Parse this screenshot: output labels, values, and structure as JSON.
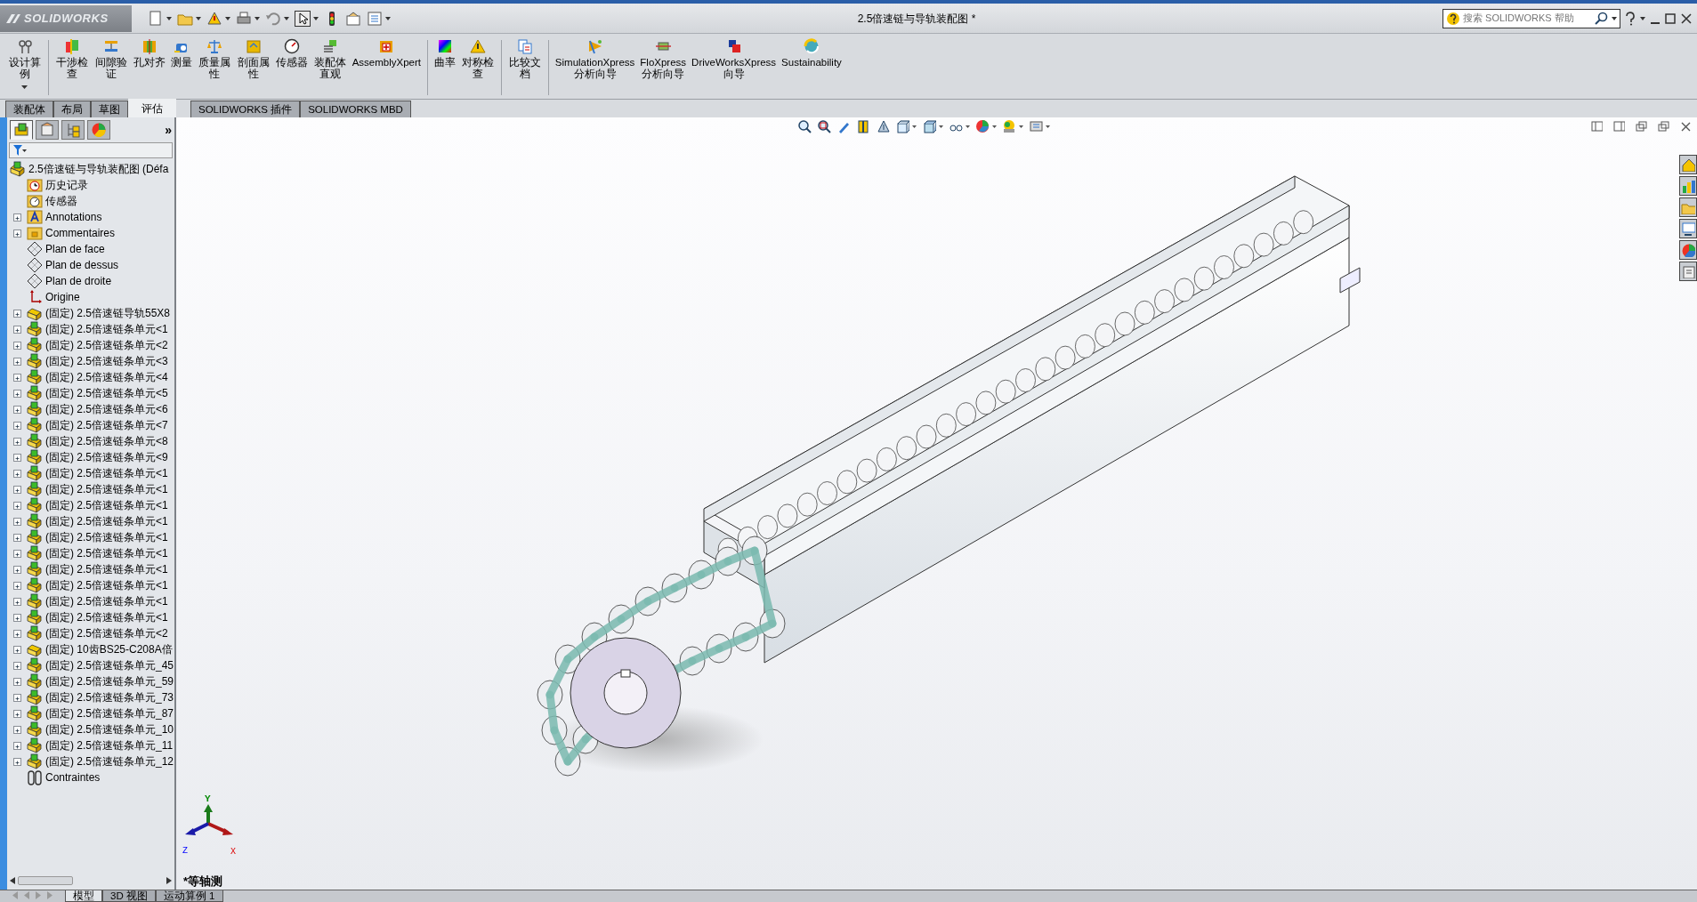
{
  "window": {
    "logo": "SOLIDWORKS",
    "title": "2.5倍速链与导轨装配图 *"
  },
  "search": {
    "placeholder": "搜索 SOLIDWORKS 帮助"
  },
  "ribbon_groups": [
    [
      {
        "label": "设计算例",
        "dropdown": true
      }
    ],
    [
      {
        "label": "干涉检查"
      },
      {
        "label": "间隙验证"
      },
      {
        "label": "孔对齐"
      },
      {
        "label": "测量"
      },
      {
        "label": "质量属性"
      },
      {
        "label": "剖面属性"
      },
      {
        "label": "传感器"
      },
      {
        "label": "装配体直观"
      },
      {
        "label": "AssemblyXpert"
      }
    ],
    [
      {
        "label": "曲率"
      },
      {
        "label": "对称检查"
      }
    ],
    [
      {
        "label": "比较文档"
      }
    ],
    [
      {
        "label": "SimulationXpress\n分析向导"
      },
      {
        "label": "FloXpress\n分析向导"
      },
      {
        "label": "DriveWorksXpress\n向导"
      },
      {
        "label": "Sustainability"
      }
    ]
  ],
  "command_tabs": [
    {
      "label": "装配体",
      "selected": false
    },
    {
      "label": "布局",
      "selected": false
    },
    {
      "label": "草图",
      "selected": false
    },
    {
      "label": "评估",
      "selected": true
    },
    {
      "label": "SOLIDWORKS 插件",
      "selected": false
    },
    {
      "label": "SOLIDWORKS MBD",
      "selected": false
    }
  ],
  "panel_tabs": [
    {
      "selected": true
    },
    {
      "selected": false
    },
    {
      "selected": false
    },
    {
      "selected": false
    }
  ],
  "panel_expand": "»",
  "tree": {
    "label": "2.5倍速链与导轨装配图  (Défa",
    "kind": "assembly",
    "children": [
      {
        "label": "历史记录",
        "kind": "history",
        "collapsed": false
      },
      {
        "label": "传感器",
        "kind": "sensor",
        "collapsed": false
      },
      {
        "label": "Annotations",
        "kind": "annotations",
        "collapsed": true
      },
      {
        "label": "Commentaires",
        "kind": "folder",
        "collapsed": true
      },
      {
        "label": "Plan de face",
        "kind": "plane",
        "collapsed": false
      },
      {
        "label": "Plan de dessus",
        "kind": "plane",
        "collapsed": false
      },
      {
        "label": "Plan de droite",
        "kind": "plane",
        "collapsed": false
      },
      {
        "label": "Origine",
        "kind": "origin",
        "collapsed": false
      },
      {
        "label": "(固定) 2.5倍速链导轨55X8",
        "kind": "part",
        "collapsed": true
      },
      {
        "label": "(固定) 2.5倍速链条单元<1",
        "kind": "assembly",
        "collapsed": true
      },
      {
        "label": "(固定) 2.5倍速链条单元<2",
        "kind": "assembly",
        "collapsed": true
      },
      {
        "label": "(固定) 2.5倍速链条单元<3",
        "kind": "assembly",
        "collapsed": true
      },
      {
        "label": "(固定) 2.5倍速链条单元<4",
        "kind": "assembly",
        "collapsed": true
      },
      {
        "label": "(固定) 2.5倍速链条单元<5",
        "kind": "assembly",
        "collapsed": true
      },
      {
        "label": "(固定) 2.5倍速链条单元<6",
        "kind": "assembly",
        "collapsed": true
      },
      {
        "label": "(固定) 2.5倍速链条单元<7",
        "kind": "assembly",
        "collapsed": true
      },
      {
        "label": "(固定) 2.5倍速链条单元<8",
        "kind": "assembly",
        "collapsed": true
      },
      {
        "label": "(固定) 2.5倍速链条单元<9",
        "kind": "assembly",
        "collapsed": true
      },
      {
        "label": "(固定) 2.5倍速链条单元<1",
        "kind": "assembly",
        "collapsed": true
      },
      {
        "label": "(固定) 2.5倍速链条单元<1",
        "kind": "assembly",
        "collapsed": true
      },
      {
        "label": "(固定) 2.5倍速链条单元<1",
        "kind": "assembly",
        "collapsed": true
      },
      {
        "label": "(固定) 2.5倍速链条单元<1",
        "kind": "assembly",
        "collapsed": true
      },
      {
        "label": "(固定) 2.5倍速链条单元<1",
        "kind": "assembly",
        "collapsed": true
      },
      {
        "label": "(固定) 2.5倍速链条单元<1",
        "kind": "assembly",
        "collapsed": true
      },
      {
        "label": "(固定) 2.5倍速链条单元<1",
        "kind": "assembly",
        "collapsed": true
      },
      {
        "label": "(固定) 2.5倍速链条单元<1",
        "kind": "assembly",
        "collapsed": true
      },
      {
        "label": "(固定) 2.5倍速链条单元<1",
        "kind": "assembly",
        "collapsed": true
      },
      {
        "label": "(固定) 2.5倍速链条单元<1",
        "kind": "assembly",
        "collapsed": true
      },
      {
        "label": "(固定) 2.5倍速链条单元<2",
        "kind": "assembly",
        "collapsed": true
      },
      {
        "label": "(固定) 10齿BS25-C208A倍",
        "kind": "part",
        "collapsed": true
      },
      {
        "label": "(固定) 2.5倍速链条单元_45",
        "kind": "assembly",
        "collapsed": true
      },
      {
        "label": "(固定) 2.5倍速链条单元_59",
        "kind": "assembly",
        "collapsed": true
      },
      {
        "label": "(固定) 2.5倍速链条单元_73",
        "kind": "assembly",
        "collapsed": true
      },
      {
        "label": "(固定) 2.5倍速链条单元_87",
        "kind": "assembly",
        "collapsed": true
      },
      {
        "label": "(固定) 2.5倍速链条单元_10",
        "kind": "assembly",
        "collapsed": true
      },
      {
        "label": "(固定) 2.5倍速链条单元_11",
        "kind": "assembly",
        "collapsed": true
      },
      {
        "label": "(固定) 2.5倍速链条单元_12",
        "kind": "assembly",
        "collapsed": true
      },
      {
        "label": "Contraintes",
        "kind": "mates",
        "collapsed": false
      }
    ]
  },
  "view_label": "*等轴测",
  "axes": {
    "x": "X",
    "y": "Y",
    "z": "Z"
  },
  "bottom_tabs": [
    {
      "label": "模型",
      "selected": true
    },
    {
      "label": "3D 视图",
      "selected": false
    },
    {
      "label": "运动算例 1",
      "selected": false
    }
  ]
}
